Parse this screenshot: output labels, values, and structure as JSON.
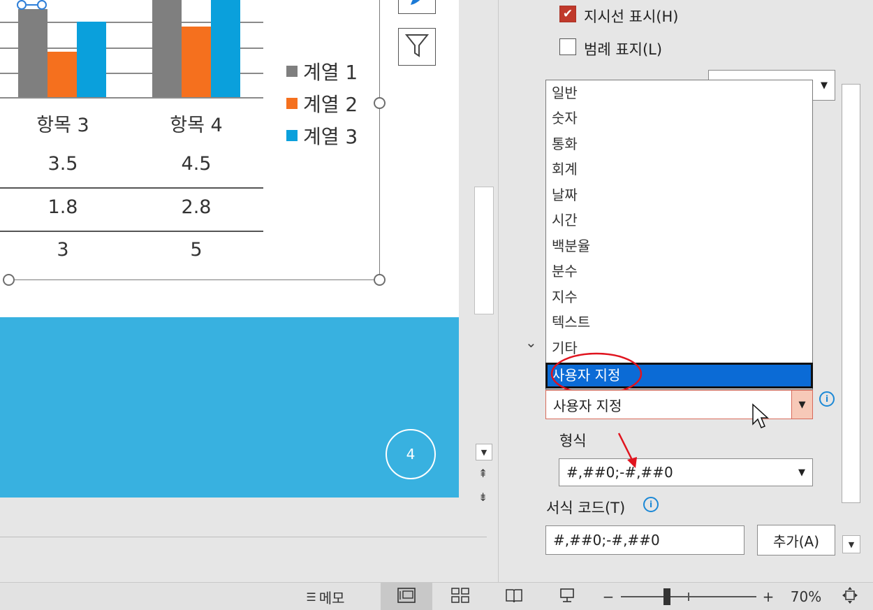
{
  "chart": {
    "categories_visible": [
      "항목 3",
      "항목 4"
    ],
    "legend": [
      {
        "label": "계열 1",
        "color": "#7f7f7f"
      },
      {
        "label": "계열 2",
        "color": "#f5701e"
      },
      {
        "label": "계열 3",
        "color": "#0aa0dc"
      }
    ],
    "data_table": [
      [
        "3.5",
        "4.5"
      ],
      [
        "1.8",
        "2.8"
      ],
      [
        "3",
        "5"
      ]
    ]
  },
  "chart_data": {
    "type": "bar",
    "categories": [
      "항목 3",
      "항목 4"
    ],
    "series": [
      {
        "name": "계열 1",
        "values": [
          3.5,
          4.5
        ]
      },
      {
        "name": "계열 2",
        "values": [
          1.8,
          2.8
        ]
      },
      {
        "name": "계열 3",
        "values": [
          3,
          5
        ]
      }
    ],
    "colors": [
      "#7f7f7f",
      "#f5701e",
      "#0aa0dc"
    ]
  },
  "slide": {
    "page_number": "4",
    "band_color": "#38b1e0"
  },
  "panel": {
    "leader_lines_label": "지시선 표시(H)",
    "leader_lines_checked": true,
    "legend_key_label": "범례 표지(L)",
    "legend_key_checked": false,
    "category_options": [
      "일반",
      "숫자",
      "통화",
      "회계",
      "날짜",
      "시간",
      "백분율",
      "분수",
      "지수",
      "텍스트",
      "기타"
    ],
    "category_selected": "사용자 지정",
    "category_combo_value": "사용자 지정",
    "type_label": "형식",
    "type_value": "#,##0;-#,##0",
    "format_code_label": "서식 코드(T)",
    "format_code_value": "#,##0;-#,##0",
    "add_button": "추가(A)"
  },
  "statusbar": {
    "notes": "메모",
    "zoom_minus": "−",
    "zoom_plus": "+",
    "zoom_level": "70%"
  },
  "icons": {
    "chart_filter": "funnel-icon",
    "chart_style": "brush-icon",
    "scroll_down": "arrow-down",
    "prev_slide": "double-up-arrow",
    "next_slide": "double-down-arrow"
  },
  "accent_colors": {
    "selection": "#0b6bd6",
    "highlight_circle": "#e0141e",
    "checkbox": "#c0392b"
  }
}
